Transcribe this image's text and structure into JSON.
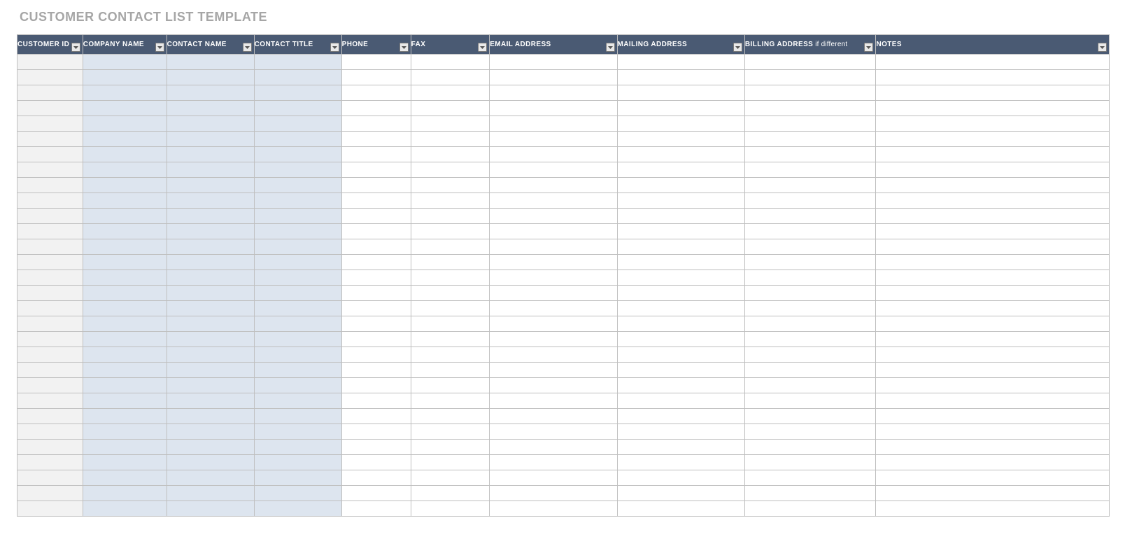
{
  "title": "CUSTOMER CONTACT LIST TEMPLATE",
  "columns": [
    {
      "label": "CUSTOMER ID",
      "shade": "grey"
    },
    {
      "label": "COMPANY NAME",
      "shade": "blue"
    },
    {
      "label": "CONTACT NAME",
      "shade": "blue"
    },
    {
      "label": "CONTACT TITLE",
      "shade": "blue"
    },
    {
      "label": "PHONE",
      "shade": "white"
    },
    {
      "label": "FAX",
      "shade": "white"
    },
    {
      "label": "EMAIL ADDRESS",
      "shade": "white"
    },
    {
      "label": "MAILING ADDRESS",
      "shade": "white"
    },
    {
      "label": "BILLING ADDRESS",
      "shade": "white",
      "sublabel": " if different"
    },
    {
      "label": "NOTES",
      "shade": "white"
    }
  ],
  "row_count": 30,
  "colors": {
    "header_bg": "#4a5a73",
    "header_fg": "#ffffff",
    "grey_cell": "#f2f2f2",
    "blue_cell": "#dde5ef",
    "white_cell": "#ffffff",
    "grid": "#bfbfbf",
    "title_fg": "#a6a6a6"
  }
}
